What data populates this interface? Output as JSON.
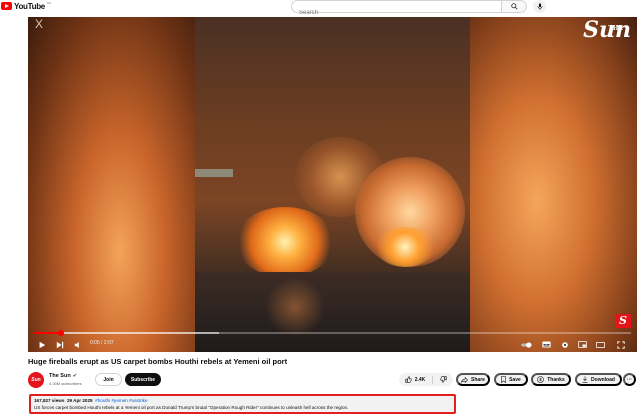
{
  "header": {
    "logo_text": "YouTube",
    "logo_country": "CC",
    "search_placeholder": "Search"
  },
  "player": {
    "overlay_x": "X",
    "watermark_the": "THE",
    "watermark_sun": "Sun",
    "badge": "S",
    "time": "0:05 / 2:07",
    "progress": 0.045,
    "buffered": 0.31
  },
  "video": {
    "title": "Huge fireballs erupt as US carpet bombs Houthi rebels at Yemeni oil port"
  },
  "channel": {
    "avatar_text": "Sun",
    "name": "The Sun",
    "subscribers": "4.33M subscribers",
    "join_label": "Join",
    "subscribe_label": "Subscribe"
  },
  "actions": {
    "likes": "2.4K",
    "share": "Share",
    "save": "Save",
    "thanks": "Thanks",
    "download": "Download",
    "more": "···"
  },
  "description": {
    "views": "167,827 views",
    "date": "29 Apr 2025",
    "tags": "#houthi #yemen #usstrike",
    "text": "US forces carpet bombed Houthi rebels at a Yemeni oil port as Donald Trump's brutal \"Operation Rough Rider\" continues to unleash hell across the region."
  },
  "colors": {
    "accent": "#ff0000",
    "highlight_border": "#e02020",
    "link": "#065fd4"
  }
}
